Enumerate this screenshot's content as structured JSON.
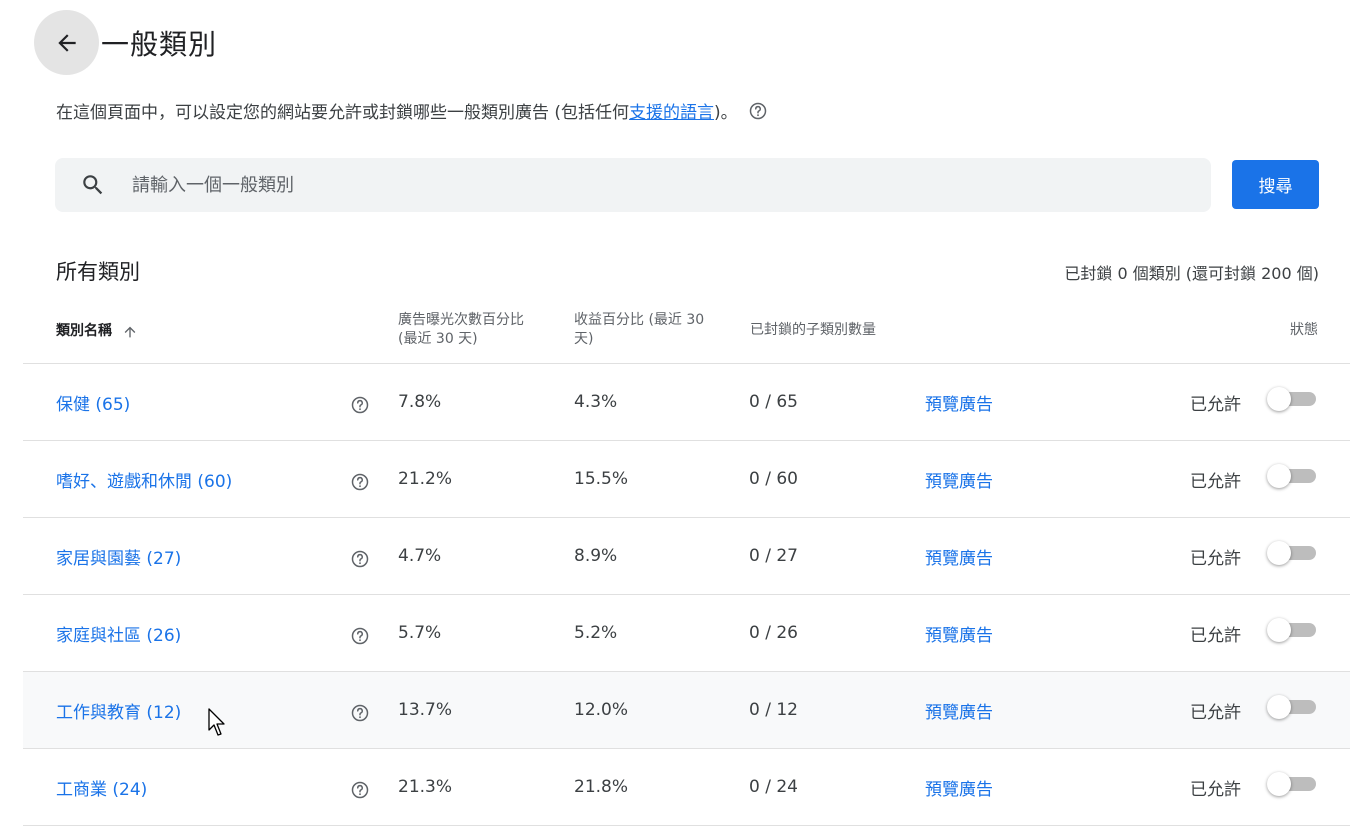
{
  "header": {
    "title": "一般類別"
  },
  "description": {
    "text_before": "在這個頁面中，可以設定您的網站要允許或封鎖哪些一般類別廣告 (包括任何",
    "link_text": "支援的語言",
    "text_after": ")。"
  },
  "search": {
    "placeholder": "請輸入一個一般類別",
    "value": "",
    "button_label": "搜尋"
  },
  "section": {
    "title": "所有類別",
    "summary": "已封鎖 0 個類別 (還可封鎖 200 個)"
  },
  "table": {
    "headers": {
      "name": "類別名稱",
      "impressions_a": "廣告曝光次數百分比",
      "impressions_b": "(最近 30 天)",
      "revenue_a": "收益百分比 (最近 30",
      "revenue_b": "天)",
      "blocked_sub": "已封鎖的子類別數量",
      "status": "狀態"
    },
    "rows": [
      {
        "name": "保健 (65)",
        "impressions": "7.8%",
        "revenue": "4.3%",
        "blocked": "0 / 65",
        "preview": "預覽廣告",
        "status": "已允許",
        "enabled": false
      },
      {
        "name": "嗜好、遊戲和休閒 (60)",
        "impressions": "21.2%",
        "revenue": "15.5%",
        "blocked": "0 / 60",
        "preview": "預覽廣告",
        "status": "已允許",
        "enabled": false
      },
      {
        "name": "家居與園藝 (27)",
        "impressions": "4.7%",
        "revenue": "8.9%",
        "blocked": "0 / 27",
        "preview": "預覽廣告",
        "status": "已允許",
        "enabled": false
      },
      {
        "name": "家庭與社區 (26)",
        "impressions": "5.7%",
        "revenue": "5.2%",
        "blocked": "0 / 26",
        "preview": "預覽廣告",
        "status": "已允許",
        "enabled": false
      },
      {
        "name": "工作與教育 (12)",
        "impressions": "13.7%",
        "revenue": "12.0%",
        "blocked": "0 / 12",
        "preview": "預覽廣告",
        "status": "已允許",
        "enabled": false
      },
      {
        "name": "工商業 (24)",
        "impressions": "21.3%",
        "revenue": "21.8%",
        "blocked": "0 / 24",
        "preview": "預覽廣告",
        "status": "已允許",
        "enabled": false
      }
    ]
  },
  "colors": {
    "accent": "#1a73e8",
    "toggle_off": "#bdbdbd",
    "search_bg": "#f1f3f4"
  }
}
